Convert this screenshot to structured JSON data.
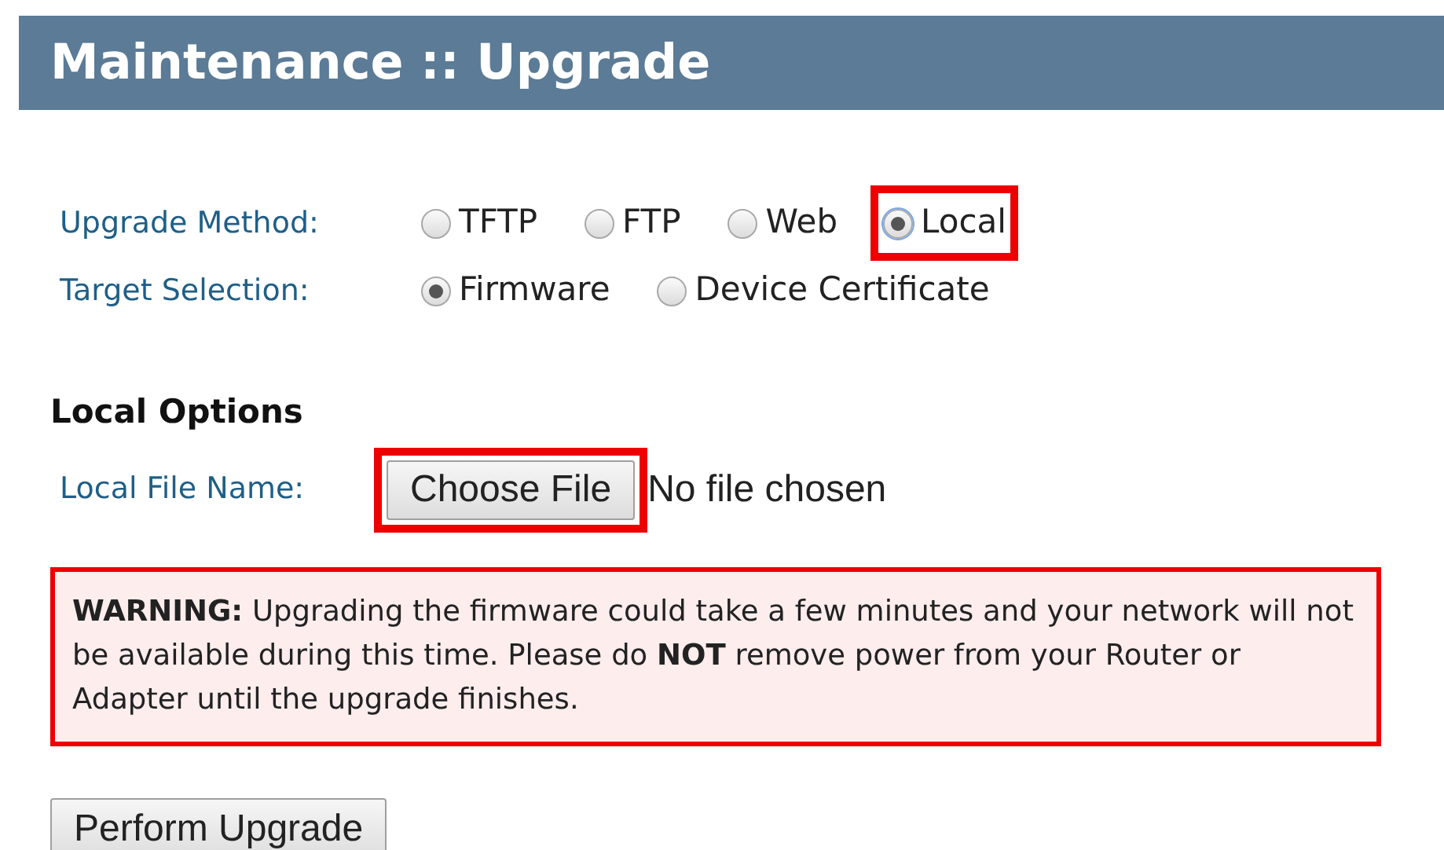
{
  "header": {
    "title": "Maintenance :: Upgrade"
  },
  "fields": [
    {
      "label": "Upgrade Method:",
      "options": [
        {
          "label": "TFTP",
          "selected": false,
          "highlighted": false
        },
        {
          "label": "FTP",
          "selected": false,
          "highlighted": false
        },
        {
          "label": "Web",
          "selected": false,
          "highlighted": false
        },
        {
          "label": "Local",
          "selected": true,
          "highlighted": true
        }
      ]
    },
    {
      "label": "Target Selection:",
      "options": [
        {
          "label": "Firmware",
          "selected": true,
          "highlighted": false
        },
        {
          "label": "Device Certificate",
          "selected": false,
          "highlighted": false
        }
      ]
    }
  ],
  "local_options": {
    "heading": "Local Options",
    "label": "Local File Name:",
    "button": "Choose File",
    "button_highlighted": true,
    "status": "No file chosen"
  },
  "warning": "**WARNING:** Upgrading the firmware could take a few minutes and your network will not be available during this time. Please do **NOT** remove power from your Router or Adapter until the upgrade finishes.",
  "submit": "Perform Upgrade"
}
